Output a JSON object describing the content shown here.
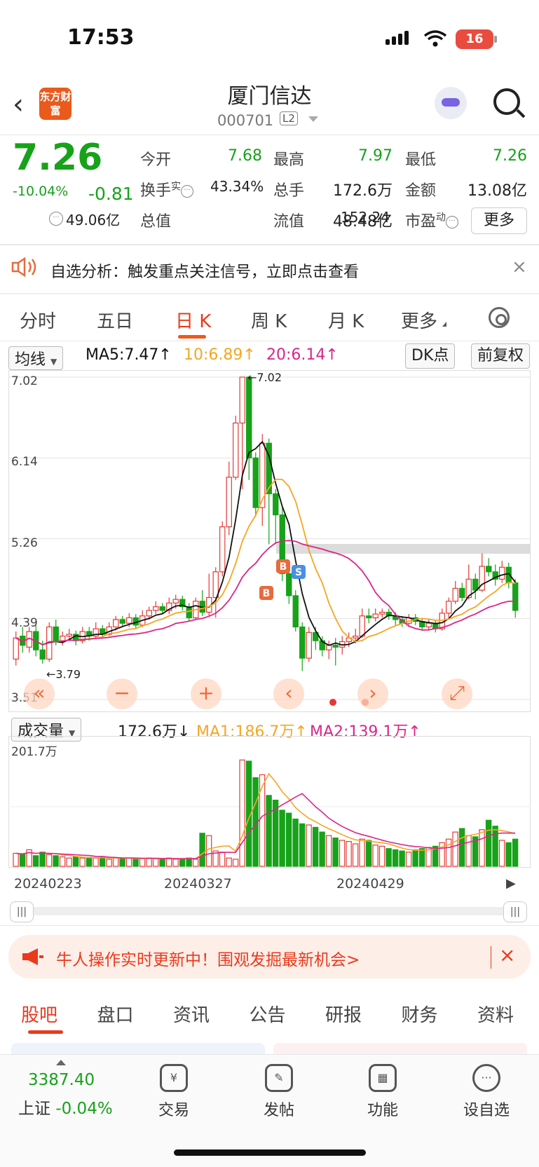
{
  "status_bar": {
    "time": "17:53",
    "battery": "16"
  },
  "header": {
    "back": "‹",
    "logo_text": "东方财富",
    "stock_name": "厦门信达",
    "stock_code": "000701",
    "level_badge": "L2"
  },
  "quote": {
    "price": "7.26",
    "change_pct": "-10.04%",
    "change": "-0.81",
    "stats": [
      {
        "label": "今开",
        "value": "7.68",
        "green": true
      },
      {
        "label": "最高",
        "value": "7.97",
        "green": true
      },
      {
        "label": "最低",
        "value": "7.26",
        "green": true
      },
      {
        "label": "换手",
        "sup": "实",
        "value": "43.34%",
        "green": false
      },
      {
        "label": "总手",
        "value": "172.6万",
        "green": false
      },
      {
        "label": "金额",
        "value": "13.08亿",
        "green": false
      },
      {
        "label": "总值",
        "value": "49.06亿",
        "green": false
      },
      {
        "label": "流值",
        "value": "48.48亿",
        "green": false
      },
      {
        "label": "市盈",
        "sup": "动",
        "value": "152.24",
        "green": false
      }
    ],
    "more_button": "更多"
  },
  "notice": {
    "text": "自选分析：触发重点关注信号，立即点击查看",
    "close": "×"
  },
  "chart_tabs": [
    "分时",
    "五日",
    "日 K",
    "周 K",
    "月 K",
    "更多"
  ],
  "ma_row": {
    "selector": "均线",
    "ma5": "MA5:7.47↑",
    "ma10": "10:6.89↑",
    "ma20": "20:6.14↑",
    "dk_button": "DK点",
    "adjust_button": "前复权"
  },
  "colors": {
    "up": "#e53935",
    "down": "#17a21a",
    "ma5": "#111111",
    "ma10": "#f5a623",
    "ma20": "#d9268a",
    "accent": "#ea3a1c"
  },
  "chart_data": [
    {
      "type": "candlestick",
      "y_ticks": [
        "7.02",
        "6.14",
        "5.26",
        "4.39",
        "3.51"
      ],
      "ylim": [
        3.51,
        7.02
      ],
      "annotations": {
        "high": "←7.02",
        "low": "←3.79"
      },
      "signals": [
        "B",
        "S",
        "B"
      ],
      "candles": [
        [
          3.95,
          4.18,
          4.25,
          3.88
        ],
        [
          4.2,
          4.1,
          4.3,
          4.02
        ],
        [
          4.08,
          4.25,
          4.3,
          4.02
        ],
        [
          4.25,
          4.05,
          4.32,
          3.98
        ],
        [
          4.05,
          3.95,
          4.15,
          3.9
        ],
        [
          3.95,
          4.3,
          4.35,
          3.92
        ],
        [
          4.3,
          4.15,
          4.38,
          4.1
        ],
        [
          4.15,
          4.2,
          4.25,
          4.1
        ],
        [
          4.2,
          4.22,
          4.28,
          4.15
        ],
        [
          4.22,
          4.15,
          4.26,
          4.1
        ],
        [
          4.15,
          4.25,
          4.3,
          4.12
        ],
        [
          4.25,
          4.2,
          4.3,
          4.15
        ],
        [
          4.2,
          4.28,
          4.35,
          4.18
        ],
        [
          4.28,
          4.22,
          4.32,
          4.18
        ],
        [
          4.22,
          4.3,
          4.35,
          4.2
        ],
        [
          4.3,
          4.38,
          4.42,
          4.26
        ],
        [
          4.38,
          4.34,
          4.42,
          4.3
        ],
        [
          4.34,
          4.4,
          4.45,
          4.3
        ],
        [
          4.4,
          4.32,
          4.44,
          4.28
        ],
        [
          4.32,
          4.42,
          4.48,
          4.3
        ],
        [
          4.42,
          4.48,
          4.52,
          4.38
        ],
        [
          4.48,
          4.52,
          4.58,
          4.44
        ],
        [
          4.52,
          4.48,
          4.56,
          4.44
        ],
        [
          4.48,
          4.56,
          4.62,
          4.44
        ],
        [
          4.56,
          4.6,
          4.65,
          4.5
        ],
        [
          4.6,
          4.52,
          4.64,
          4.48
        ],
        [
          4.52,
          4.4,
          4.56,
          4.36
        ],
        [
          4.4,
          4.58,
          4.62,
          4.38
        ],
        [
          4.58,
          4.46,
          4.7,
          4.42
        ],
        [
          4.46,
          4.62,
          4.88,
          4.42
        ],
        [
          4.62,
          4.9,
          4.95,
          4.4
        ],
        [
          4.9,
          5.39,
          5.45,
          4.85
        ],
        [
          5.39,
          5.93,
          6.1,
          5.3
        ],
        [
          5.93,
          6.52,
          6.6,
          5.9
        ],
        [
          6.52,
          7.02,
          7.02,
          5.8
        ],
        [
          7.02,
          6.14,
          7.02,
          5.9
        ],
        [
          6.14,
          5.6,
          6.2,
          5.5
        ],
        [
          5.6,
          6.3,
          6.4,
          5.4
        ],
        [
          6.3,
          5.75,
          6.35,
          5.2
        ],
        [
          5.75,
          5.52,
          5.8,
          5.2
        ],
        [
          5.52,
          4.88,
          5.6,
          4.8
        ],
        [
          4.88,
          4.64,
          4.95,
          4.55
        ],
        [
          4.64,
          4.3,
          4.7,
          4.25
        ],
        [
          4.3,
          3.96,
          4.35,
          3.82
        ],
        [
          3.96,
          4.24,
          4.3,
          3.92
        ],
        [
          4.24,
          4.15,
          4.3,
          4.05
        ],
        [
          4.15,
          4.05,
          4.2,
          3.98
        ],
        [
          4.05,
          4.1,
          4.15,
          3.95
        ],
        [
          4.1,
          4.08,
          4.18,
          3.88
        ],
        [
          4.08,
          4.14,
          4.2,
          4.0
        ],
        [
          4.14,
          4.18,
          4.24,
          4.08
        ],
        [
          4.18,
          4.2,
          4.28,
          4.12
        ],
        [
          4.2,
          4.42,
          4.5,
          4.18
        ],
        [
          4.42,
          4.4,
          4.5,
          4.34
        ],
        [
          4.4,
          4.44,
          4.5,
          4.36
        ],
        [
          4.44,
          4.46,
          4.5,
          4.4
        ],
        [
          4.46,
          4.42,
          4.5,
          4.38
        ],
        [
          4.42,
          4.38,
          4.46,
          4.32
        ],
        [
          4.38,
          4.34,
          4.42,
          4.3
        ],
        [
          4.34,
          4.4,
          4.44,
          4.3
        ],
        [
          4.4,
          4.36,
          4.44,
          4.32
        ],
        [
          4.36,
          4.3,
          4.4,
          4.26
        ],
        [
          4.3,
          4.34,
          4.38,
          4.26
        ],
        [
          4.34,
          4.28,
          4.38,
          4.24
        ],
        [
          4.28,
          4.45,
          4.5,
          4.26
        ],
        [
          4.45,
          4.58,
          4.62,
          4.4
        ],
        [
          4.58,
          4.72,
          4.8,
          4.55
        ],
        [
          4.72,
          4.62,
          4.78,
          4.58
        ],
        [
          4.62,
          4.82,
          4.98,
          4.6
        ],
        [
          4.82,
          4.7,
          4.88,
          4.6
        ],
        [
          4.7,
          4.96,
          5.1,
          4.68
        ],
        [
          4.96,
          4.9,
          5.05,
          4.85
        ],
        [
          4.9,
          4.82,
          4.98,
          4.75
        ],
        [
          4.82,
          4.95,
          5.02,
          4.78
        ],
        [
          4.95,
          4.78,
          5.0,
          4.72
        ],
        [
          4.78,
          4.48,
          4.82,
          4.4
        ]
      ]
    },
    {
      "type": "bar",
      "selector": "成交量",
      "current": "172.6万↓",
      "ma1": "MA1:186.7万↑",
      "ma2": "MA2:139.1万↑",
      "y_max_label": "201.7万",
      "ylim": [
        0,
        201.7
      ],
      "x_tick_labels": [
        "20240223",
        "20240327",
        "20240429"
      ],
      "values": [
        22,
        20,
        28,
        18,
        24,
        20,
        18,
        16,
        14,
        16,
        14,
        15,
        14,
        16,
        12,
        14,
        13,
        14,
        12,
        13,
        14,
        13,
        12,
        14,
        12,
        13,
        14,
        12,
        56,
        52,
        26,
        24,
        14,
        12,
        180,
        178,
        150,
        155,
        120,
        112,
        95,
        90,
        80,
        72,
        70,
        66,
        58,
        52,
        48,
        44,
        42,
        38,
        46,
        44,
        36,
        34,
        30,
        28,
        26,
        24,
        28,
        30,
        32,
        34,
        40,
        46,
        58,
        64,
        52,
        50,
        62,
        78,
        68,
        44,
        40,
        46
      ]
    }
  ],
  "chart_controls": [
    "«",
    "−",
    "+",
    "‹",
    "›",
    "⤢"
  ],
  "banner": {
    "text": "牛人操作实时更新中！围观发掘最新机会>",
    "close": "×"
  },
  "main_tabs": [
    "股吧",
    "盘口",
    "资讯",
    "公告",
    "研报",
    "财务",
    "资料"
  ],
  "bottom_bar": {
    "index_value": "3387.40",
    "index_label": "上证",
    "index_change": "-0.04%",
    "nav": [
      {
        "label": "交易",
        "icon": "¥"
      },
      {
        "label": "发帖",
        "icon": "✎"
      },
      {
        "label": "功能",
        "icon": "▦"
      },
      {
        "label": "设自选",
        "icon": "···"
      }
    ]
  }
}
